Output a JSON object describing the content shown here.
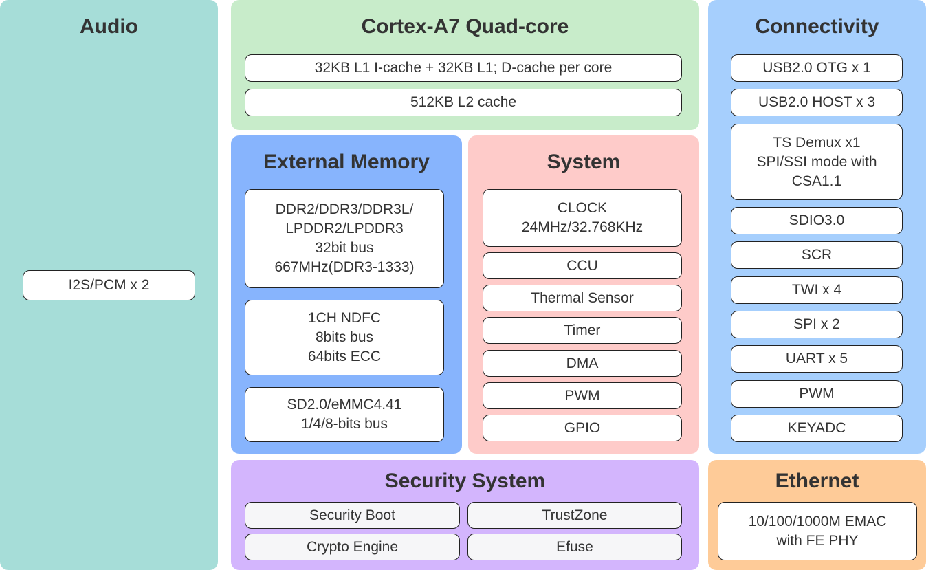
{
  "colors": {
    "audio": "#a6ddd8",
    "cpu": "#c8ecca",
    "memory": "#87b4fd",
    "system": "#fecbc9",
    "connectivity": "#a6cffd",
    "security": "#d3b5fd",
    "ethernet": "#fecb98"
  },
  "audio": {
    "title": "Audio",
    "items": [
      "I2S/PCM x 2"
    ]
  },
  "cpu": {
    "title": "Cortex-A7 Quad-core",
    "items": [
      "32KB L1 I-cache + 32KB L1;  D-cache per core",
      "512KB L2 cache"
    ]
  },
  "memory": {
    "title": "External Memory",
    "items": [
      "DDR2/DDR3/DDR3L/\nLPDDR2/LPDDR3\n32bit bus\n667MHz(DDR3-1333)",
      "1CH NDFC\n8bits bus\n64bits ECC",
      "SD2.0/eMMC4.41\n1/4/8-bits bus"
    ]
  },
  "system": {
    "title": "System",
    "items": [
      "CLOCK\n24MHz/32.768KHz",
      "CCU",
      "Thermal Sensor",
      "Timer",
      "DMA",
      "PWM",
      "GPIO"
    ]
  },
  "connectivity": {
    "title": "Connectivity",
    "items": [
      "USB2.0 OTG x 1",
      "USB2.0 HOST x 3",
      "TS Demux x1\nSPI/SSI mode with\nCSA1.1",
      "SDIO3.0",
      "SCR",
      "TWI x 4",
      "SPI x 2",
      "UART x 5",
      "PWM",
      "KEYADC"
    ]
  },
  "security": {
    "title": "Security System",
    "items": [
      "Security Boot",
      "TrustZone",
      "Crypto Engine",
      "Efuse"
    ]
  },
  "ethernet": {
    "title": "Ethernet",
    "items": [
      "10/100/1000M EMAC\nwith FE PHY"
    ]
  }
}
